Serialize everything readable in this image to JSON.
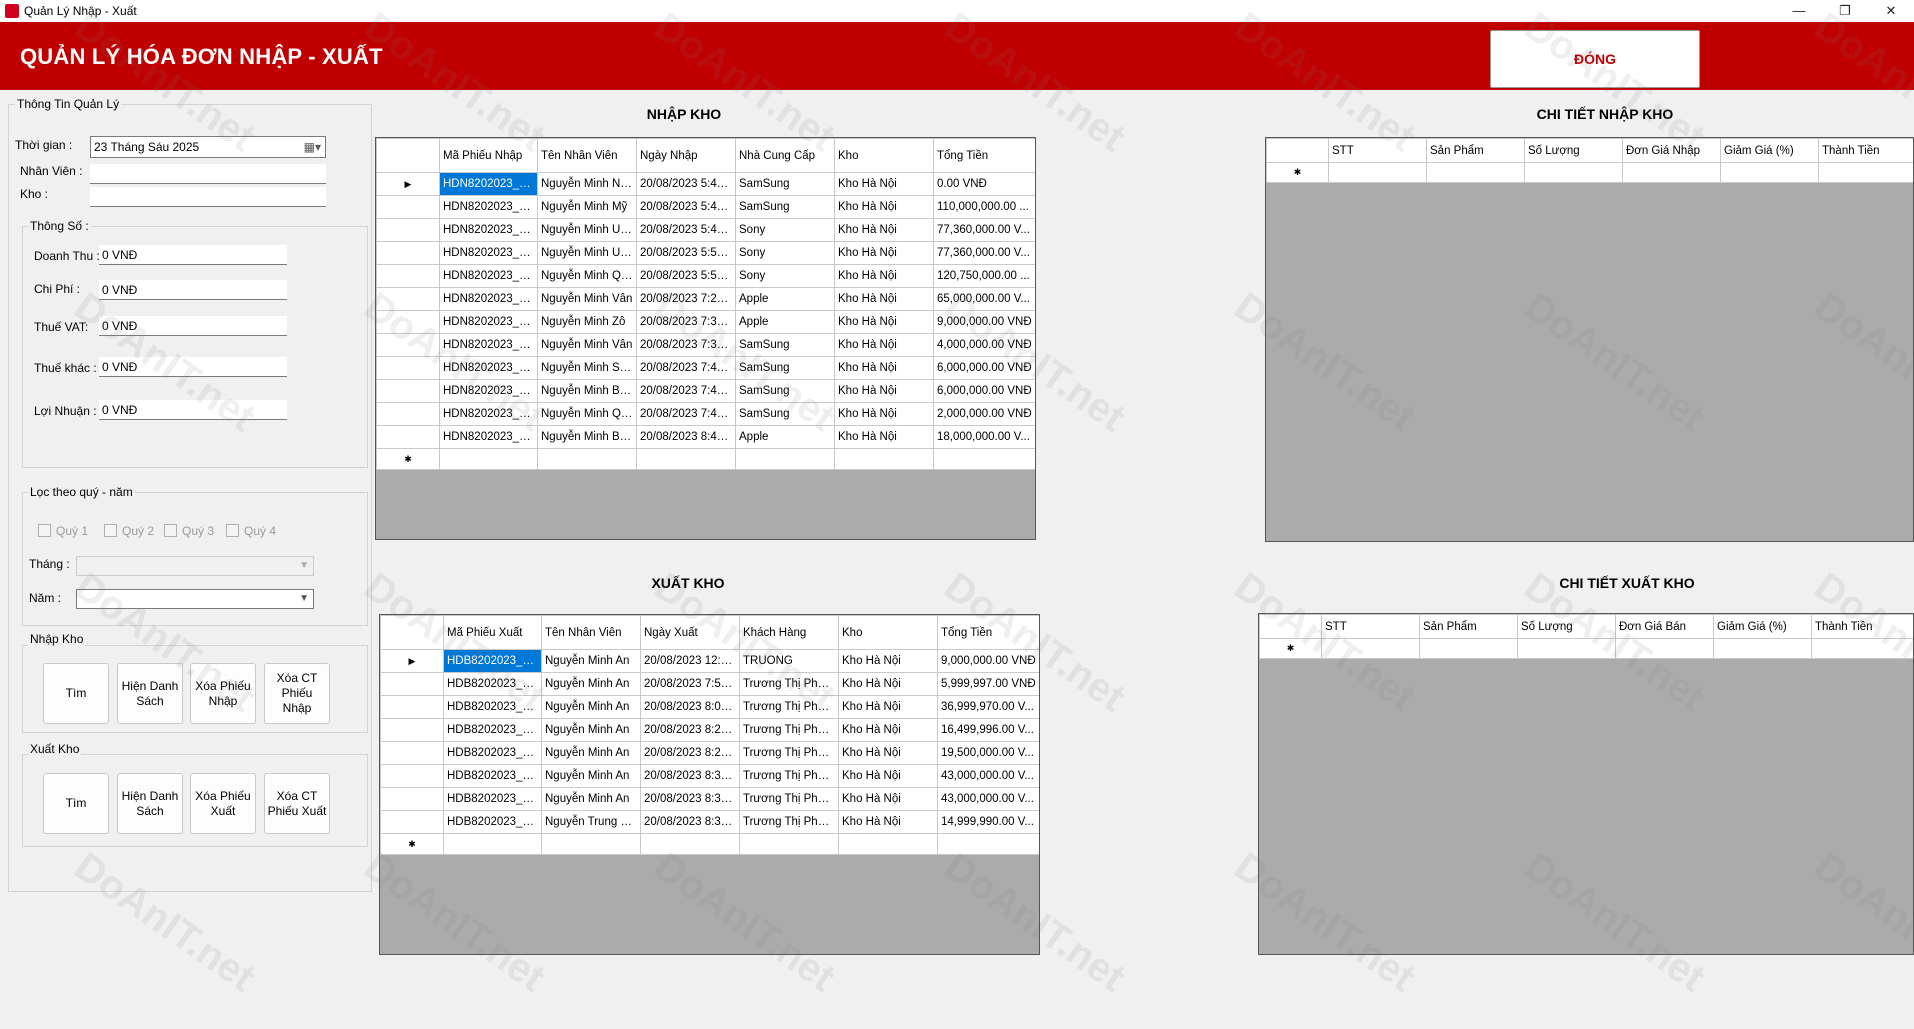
{
  "window": {
    "title": "Quản Lý Nhập - Xuất",
    "controls": [
      "—",
      "❐",
      "✕"
    ]
  },
  "header": {
    "title": "QUẢN LÝ HÓA ĐƠN NHẬP - XUẤT",
    "close_label": "ĐÓNG"
  },
  "info_panel": {
    "group_title": "Thông Tin Quản Lý",
    "time_label": "Thời gian :",
    "date_value": "23    Tháng Sáu      2025",
    "employee_label": "Nhân Viên :",
    "employee_value": "",
    "warehouse_label": "Kho :",
    "warehouse_value": "",
    "stats": {
      "title": "Thông Số :",
      "revenue_label": "Doanh Thu :",
      "revenue_value": "0 VNĐ",
      "cost_label": "Chi Phí :",
      "cost_value": "0 VNĐ",
      "vat_label": "Thuế VAT:",
      "vat_value": "0 VNĐ",
      "other_tax_label": "Thuế khác :",
      "other_tax_value": "0 VNĐ",
      "profit_label": "Lợi Nhuận :",
      "profit_value": "0 VNĐ"
    },
    "filter": {
      "title": "Lọc theo quý - năm",
      "quarters": [
        "Quý 1",
        "Quý 2",
        "Quý 3",
        "Quý 4"
      ],
      "month_label": "Tháng :",
      "month_value": "",
      "year_label": "Năm :",
      "year_value": ""
    },
    "import_group": {
      "title": "Nhập Kho",
      "buttons": [
        "Tìm",
        "Hiện Danh Sách",
        "Xóa Phiếu Nhập",
        "Xóa CT Phiếu Nhập"
      ]
    },
    "export_group": {
      "title": "Xuất Kho",
      "buttons": [
        "Tìm",
        "Hiện Danh Sách",
        "Xóa Phiếu Xuất",
        "Xóa CT Phiếu Xuất"
      ]
    }
  },
  "import_grid": {
    "title": "NHẬP KHO",
    "columns": [
      "Mã Phiếu Nhập",
      "Tên Nhân Viên",
      "Ngày Nhập",
      "Nhà Cung Cấp",
      "Kho",
      "Tổng Tiền"
    ],
    "rows": [
      [
        "HDN8202023_1...",
        "Nguyễn Minh Nga",
        "20/08/2023 5:40...",
        "SamSung",
        "Kho Hà Nội",
        "0.00 VNĐ"
      ],
      [
        "HDN8202023_1...",
        "Nguyễn Minh Mỹ",
        "20/08/2023 5:44...",
        "SamSung",
        "Kho Hà Nội",
        "110,000,000.00 ..."
      ],
      [
        "HDN8202023_1...",
        "Nguyễn Minh Uyên",
        "20/08/2023 5:49...",
        "Sony",
        "Kho Hà Nội",
        "77,360,000.00 V..."
      ],
      [
        "HDN8202023_1...",
        "Nguyễn Minh Uyên",
        "20/08/2023 5:55...",
        "Sony",
        "Kho Hà Nội",
        "77,360,000.00 V..."
      ],
      [
        "HDN8202023_1...",
        "Nguyễn Minh Qu...",
        "20/08/2023 5:57...",
        "Sony",
        "Kho Hà Nội",
        "120,750,000.00 ..."
      ],
      [
        "HDN8202023_1...",
        "Nguyễn Minh Vân",
        "20/08/2023 7:20...",
        "Apple",
        "Kho Hà Nội",
        "65,000,000.00 V..."
      ],
      [
        "HDN8202023_1...",
        "Nguyễn Minh Zô",
        "20/08/2023 7:36...",
        "Apple",
        "Kho Hà Nội",
        "9,000,000.00 VNĐ"
      ],
      [
        "HDN8202023_1...",
        "Nguyễn Minh Vân",
        "20/08/2023 7:39...",
        "SamSung",
        "Kho Hà Nội",
        "4,000,000.00 VNĐ"
      ],
      [
        "HDN8202023_1...",
        "Nguyễn Minh Sơn",
        "20/08/2023 7:42...",
        "SamSung",
        "Kho Hà Nội",
        "6,000,000.00 VNĐ"
      ],
      [
        "HDN8202023_1...",
        "Nguyễn Minh Bình",
        "20/08/2023 7:44...",
        "SamSung",
        "Kho Hà Nội",
        "6,000,000.00 VNĐ"
      ],
      [
        "HDN8202023_1...",
        "Nguyễn Minh Qu...",
        "20/08/2023 7:47...",
        "SamSung",
        "Kho Hà Nội",
        "2,000,000.00 VNĐ"
      ],
      [
        "HDN8202023_2...",
        "Nguyễn Minh Bình",
        "20/08/2023 8:47...",
        "Apple",
        "Kho Hà Nội",
        "18,000,000.00 V..."
      ]
    ]
  },
  "import_detail_grid": {
    "title": "CHI TIẾT NHẬP KHO",
    "columns": [
      "STT",
      "Sản Phẩm",
      "Số Lượng",
      "Đơn Giá Nhập",
      "Giảm Giá (%)",
      "Thành Tiền"
    ]
  },
  "export_grid": {
    "title": "XUẤT KHO",
    "columns": [
      "Mã Phiếu Xuất",
      "Tên Nhân Viên",
      "Ngày Xuất",
      "Khách Hàng",
      "Kho",
      "Tổng Tiền"
    ],
    "rows": [
      [
        "HDB8202023_0...",
        "Nguyễn Minh An",
        "20/08/2023 12:4...",
        "TRUONG",
        "Kho Hà Nội",
        "9,000,000.00 VNĐ"
      ],
      [
        "HDB8202023_1...",
        "Nguyễn Minh An",
        "20/08/2023 7:56...",
        "Trương Thị Phượ...",
        "Kho Hà Nội",
        "5,999,997.00 VNĐ"
      ],
      [
        "HDB8202023_2...",
        "Nguyễn Minh An",
        "20/08/2023 8:08...",
        "Trương Thị Phượ...",
        "Kho Hà Nội",
        "36,999,970.00 V..."
      ],
      [
        "HDB8202023_2...",
        "Nguyễn Minh An",
        "20/08/2023 8:22...",
        "Trương Thị Phượ...",
        "Kho Hà Nội",
        "16,499,996.00 V..."
      ],
      [
        "HDB8202023_2...",
        "Nguyễn Minh An",
        "20/08/2023 8:26...",
        "Trương Thị Phượ...",
        "Kho Hà Nội",
        "19,500,000.00 V..."
      ],
      [
        "HDB8202023_2...",
        "Nguyễn Minh An",
        "20/08/2023 8:30...",
        "Trương Thị Phượ...",
        "Kho Hà Nội",
        "43,000,000.00 V..."
      ],
      [
        "HDB8202023_2...",
        "Nguyễn Minh An",
        "20/08/2023 8:31...",
        "Trương Thị Phượ...",
        "Kho Hà Nội",
        "43,000,000.00 V..."
      ],
      [
        "HDB8202023_2...",
        "Nguyễn Trung Kiên",
        "20/08/2023 8:33...",
        "Trương Thị Phượ...",
        "Kho Hà Nội",
        "14,999,990.00 V..."
      ]
    ]
  },
  "export_detail_grid": {
    "title": "CHI TIẾT XUẤT KHO",
    "columns": [
      "STT",
      "Sản Phẩm",
      "Số Lượng",
      "Đơn Giá Bán",
      "Giảm Giá (%)",
      "Thành Tiền"
    ]
  },
  "watermark": "DoAnIT.net",
  "colors": {
    "header_red": "#c00000",
    "selection_blue": "#0078d7",
    "grid_empty": "#ababab"
  }
}
